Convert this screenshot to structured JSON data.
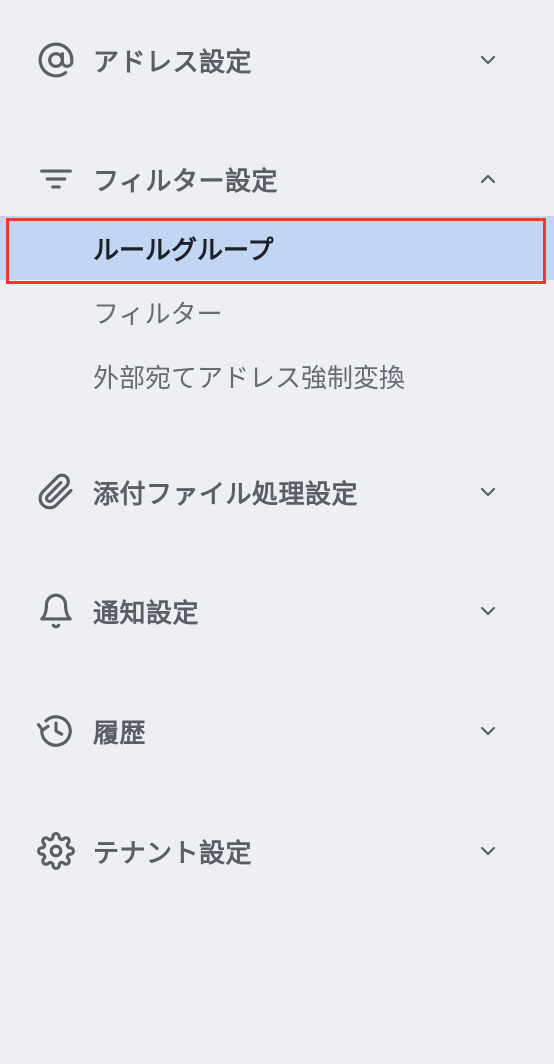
{
  "sections": [
    {
      "key": "address",
      "label": "アドレス設定",
      "icon": "at-sign-icon",
      "expanded": false
    },
    {
      "key": "filter",
      "label": "フィルター設定",
      "icon": "filter-lines-icon",
      "expanded": true,
      "items": [
        {
          "label": "ルールグループ",
          "active": true
        },
        {
          "label": "フィルター",
          "active": false
        },
        {
          "label": "外部宛てアドレス強制変換",
          "active": false
        }
      ]
    },
    {
      "key": "attachment",
      "label": "添付ファイル処理設定",
      "icon": "paperclip-icon",
      "expanded": false
    },
    {
      "key": "notification",
      "label": "通知設定",
      "icon": "bell-icon",
      "expanded": false
    },
    {
      "key": "history",
      "label": "履歴",
      "icon": "history-icon",
      "expanded": false
    },
    {
      "key": "tenant",
      "label": "テナント設定",
      "icon": "gear-icon",
      "expanded": false
    }
  ],
  "colors": {
    "background": "#eeeff3",
    "active_item_bg": "#c2d6f3",
    "highlight_border": "#e83a2f",
    "text": "#5a5f67",
    "active_text": "#1c2028"
  }
}
